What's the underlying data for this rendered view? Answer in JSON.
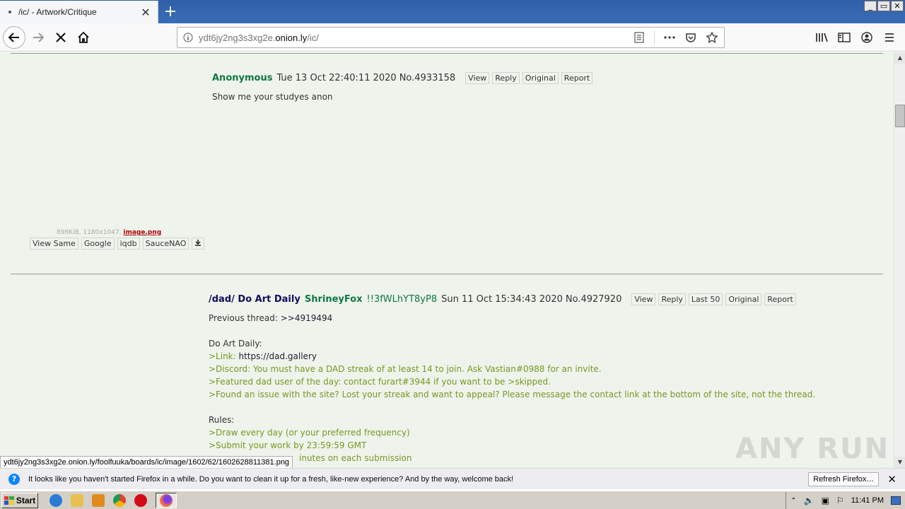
{
  "browser": {
    "tab_title": "/ic/ - Artwork/Critique",
    "url_prefix": "ydt6jy2ng3s3xg2e.",
    "url_domain": "onion.ly",
    "url_path": "/ic/",
    "window_buttons": [
      "_",
      "▭",
      "✕"
    ],
    "new_tab_label": "+"
  },
  "posts": [
    {
      "name": "Anonymous",
      "date": "Tue 13 Oct 22:40:11 2020",
      "no": "No.4933158",
      "buttons": [
        "View",
        "Reply",
        "Original",
        "Report"
      ],
      "comment": "Show me your studyes anon",
      "file": {
        "info": "898KiB, 1180x1047,",
        "filename": "image.png",
        "buttons": [
          "View Same",
          "Google",
          "iqdb",
          "SauceNAO"
        ]
      }
    },
    {
      "subject": "/dad/ Do Art Daily",
      "name": "ShrineyFox",
      "trip": "!!3fWLhYT8yP8",
      "date": "Sun 11 Oct 15:34:43 2020",
      "no": "No.4927920",
      "buttons": [
        "View",
        "Reply",
        "Last 50",
        "Original",
        "Report"
      ],
      "lines": {
        "prev_label": "Previous thread: ",
        "prev_link": ">>4919494",
        "dad_header": "Do Art Daily:",
        "link_label": ">Link: ",
        "link_url": "https://dad.gallery",
        "discord": ">Discord: You must have a DAD streak of at least 14 to join. Ask Vastian#0988 for an invite.",
        "featured": ">Featured dad user of the day: contact furart#3944 if you want to be >skipped.",
        "found_issue": ">Found an issue with the site? Lost your streak and want to appeal? Please message the contact link at the bottom of the site, not the thread.",
        "rules_header": "Rules:",
        "rule1": ">Draw every day (or your preferred frequency)",
        "rule2": ">Submit your work by 23:59:59 GMT",
        "rule3_partial": "inutes on each submission"
      }
    }
  ],
  "status_link": "ydt6jy2ng3s3xg2e.onion.ly/foolfuuka/boards/ic/image/1602/62/1602628811381.png",
  "notification": {
    "message": "It looks like you haven't started Firefox in a while. Do you want to clean it up for a fresh, like-new experience? And by the way, welcome back!",
    "button": "Refresh Firefox…"
  },
  "taskbar": {
    "start_label": "Start",
    "clock": "11:41 PM"
  },
  "watermark": "ANY RUN"
}
